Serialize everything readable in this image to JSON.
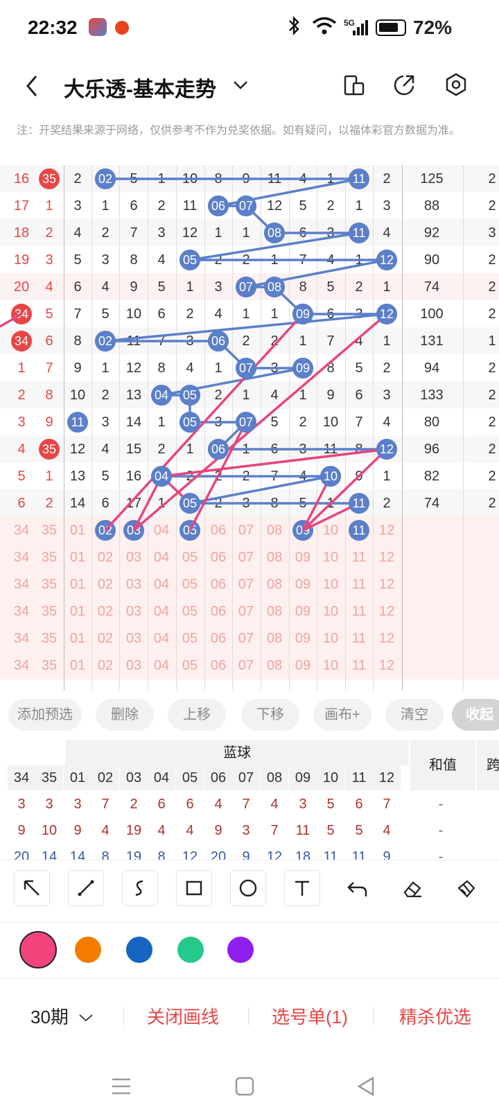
{
  "status_bar": {
    "time": "22:32",
    "battery": "72%",
    "network": "5G"
  },
  "header": {
    "title": "大乐透-基本走势"
  },
  "note": "注：开奖结果来源于网络，仅供参考不作为兑奖依据。如有疑问，以福体彩官方数据为准。",
  "trend": {
    "rows": [
      {
        "left": [
          "16",
          "35"
        ],
        "nums": [
          "2",
          "02",
          "5",
          "1",
          "10",
          "8",
          "9",
          "11",
          "4",
          "1",
          "11",
          "2"
        ],
        "sum": "125",
        "tail": "2"
      },
      {
        "left": [
          "17",
          "1"
        ],
        "nums": [
          "3",
          "1",
          "6",
          "2",
          "11",
          "06",
          "07",
          "12",
          "5",
          "2",
          "1",
          "3"
        ],
        "sum": "88",
        "tail": "2"
      },
      {
        "left": [
          "18",
          "2"
        ],
        "nums": [
          "4",
          "2",
          "7",
          "3",
          "12",
          "1",
          "1",
          "08",
          "6",
          "3",
          "11",
          "4"
        ],
        "sum": "92",
        "tail": "3"
      },
      {
        "left": [
          "19",
          "3"
        ],
        "nums": [
          "5",
          "3",
          "8",
          "4",
          "05",
          "2",
          "2",
          "1",
          "7",
          "4",
          "1",
          "12"
        ],
        "sum": "90",
        "tail": "2"
      },
      {
        "left": [
          "20",
          "4"
        ],
        "nums": [
          "6",
          "4",
          "9",
          "5",
          "1",
          "3",
          "07",
          "08",
          "8",
          "5",
          "2",
          "1"
        ],
        "sum": "74",
        "tail": "2"
      },
      {
        "left": [
          "34",
          "5"
        ],
        "nums": [
          "7",
          "5",
          "10",
          "6",
          "2",
          "4",
          "1",
          "1",
          "09",
          "6",
          "3",
          "12"
        ],
        "sum": "100",
        "tail": "2"
      },
      {
        "left": [
          "34",
          "6"
        ],
        "nums": [
          "8",
          "02",
          "11",
          "7",
          "3",
          "06",
          "2",
          "2",
          "1",
          "7",
          "4",
          "1"
        ],
        "sum": "131",
        "tail": "1"
      },
      {
        "left": [
          "1",
          "7"
        ],
        "nums": [
          "9",
          "1",
          "12",
          "8",
          "4",
          "1",
          "07",
          "3",
          "09",
          "8",
          "5",
          "2"
        ],
        "sum": "94",
        "tail": "2"
      },
      {
        "left": [
          "2",
          "8"
        ],
        "nums": [
          "10",
          "2",
          "13",
          "04",
          "05",
          "2",
          "1",
          "4",
          "1",
          "9",
          "6",
          "3"
        ],
        "sum": "133",
        "tail": "2"
      },
      {
        "left": [
          "3",
          "9"
        ],
        "nums": [
          "11",
          "3",
          "14",
          "1",
          "05",
          "3",
          "07",
          "5",
          "2",
          "10",
          "7",
          "4"
        ],
        "sum": "80",
        "tail": "2"
      },
      {
        "left": [
          "4",
          "35"
        ],
        "nums": [
          "12",
          "4",
          "15",
          "2",
          "1",
          "06",
          "1",
          "6",
          "3",
          "11",
          "8",
          "12"
        ],
        "sum": "96",
        "tail": "2"
      },
      {
        "left": [
          "5",
          "1"
        ],
        "nums": [
          "13",
          "5",
          "16",
          "04",
          "2",
          "2",
          "2",
          "7",
          "4",
          "10",
          "9",
          "1"
        ],
        "sum": "82",
        "tail": "2"
      },
      {
        "left": [
          "6",
          "2"
        ],
        "nums": [
          "14",
          "6",
          "17",
          "1",
          "05",
          "2",
          "3",
          "8",
          "5",
          "1",
          "11",
          "2"
        ],
        "sum": "74",
        "tail": "2"
      }
    ],
    "pick_rows": [
      {
        "left": [
          "34",
          "35"
        ],
        "nums": [
          "01",
          "02",
          "03",
          "04",
          "05",
          "06",
          "07",
          "08",
          "09",
          "10",
          "11",
          "12"
        ]
      },
      {
        "left": [
          "34",
          "35"
        ],
        "nums": [
          "01",
          "02",
          "03",
          "04",
          "05",
          "06",
          "07",
          "08",
          "09",
          "10",
          "11",
          "12"
        ]
      },
      {
        "left": [
          "34",
          "35"
        ],
        "nums": [
          "01",
          "02",
          "03",
          "04",
          "05",
          "06",
          "07",
          "08",
          "09",
          "10",
          "11",
          "12"
        ]
      },
      {
        "left": [
          "34",
          "35"
        ],
        "nums": [
          "01",
          "02",
          "03",
          "04",
          "05",
          "06",
          "07",
          "08",
          "09",
          "10",
          "11",
          "12"
        ]
      },
      {
        "left": [
          "34",
          "35"
        ],
        "nums": [
          "01",
          "02",
          "03",
          "04",
          "05",
          "06",
          "07",
          "08",
          "09",
          "10",
          "11",
          "12"
        ]
      },
      {
        "left": [
          "34",
          "35"
        ],
        "nums": [
          "01",
          "02",
          "03",
          "04",
          "05",
          "06",
          "07",
          "08",
          "09",
          "10",
          "11",
          "12"
        ]
      }
    ]
  },
  "actions": {
    "add": "添加预选",
    "delete": "删除",
    "up": "上移",
    "down": "下移",
    "canvas": "画布+",
    "clear": "清空",
    "collapse": "收起"
  },
  "stats": {
    "blue_header": "蓝球",
    "sum_header": "和值",
    "span_header": "跨",
    "cols": [
      "34",
      "35",
      "01",
      "02",
      "03",
      "04",
      "05",
      "06",
      "07",
      "08",
      "09",
      "10",
      "11",
      "12"
    ],
    "rows": [
      [
        "3",
        "3",
        "3",
        "7",
        "2",
        "6",
        "6",
        "4",
        "7",
        "4",
        "3",
        "5",
        "6",
        "7",
        "-"
      ],
      [
        "9",
        "10",
        "9",
        "4",
        "19",
        "4",
        "4",
        "9",
        "3",
        "7",
        "11",
        "5",
        "5",
        "4",
        "-"
      ],
      [
        "20",
        "14",
        "14",
        "8",
        "19",
        "8",
        "12",
        "20",
        "9",
        "12",
        "18",
        "11",
        "11",
        "9",
        "-"
      ]
    ]
  },
  "colors": {
    "pink": "#f2447a",
    "orange": "#f57c00",
    "blue": "#1565c0",
    "green": "#26c98a",
    "purple": "#8e1ff0",
    "ball_blue": "#5b7fc9",
    "ball_red": "#e84545",
    "line_pink": "#e8457e",
    "line_blue": "#5b7fc9"
  },
  "bottom": {
    "period": "30期",
    "close_draw": "关闭画线",
    "pick_list": "选号单(1)",
    "best": "精杀优选"
  }
}
